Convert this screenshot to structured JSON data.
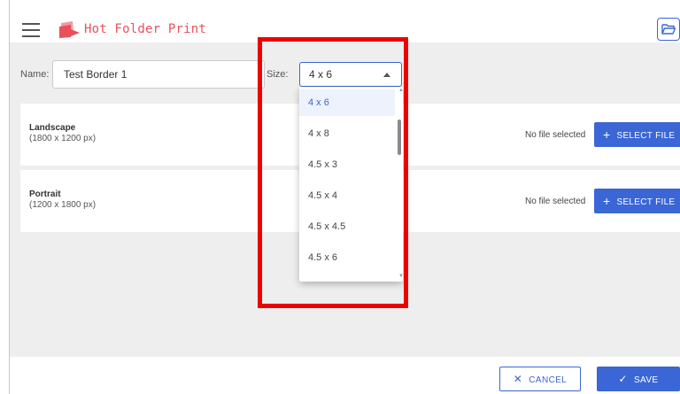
{
  "app": {
    "title": "Hot Folder Print",
    "accent_color": "#3b66d6",
    "logo_color": "#e8505b"
  },
  "form": {
    "name_label": "Name:",
    "name_value": "Test Border 1",
    "size_label": "Size:",
    "size_value": "4 x 6"
  },
  "size_options": [
    "4 x 6",
    "4 x 8",
    "4.5 x 3",
    "4.5 x 4",
    "4.5 x 4.5",
    "4.5 x 6"
  ],
  "panels": {
    "landscape": {
      "title": "Landscape",
      "subtitle": "(1800 x 1200 px)",
      "status": "No file selected",
      "button_label": "SELECT FILE",
      "button_icon": "plus-icon"
    },
    "portrait": {
      "title": "Portrait",
      "subtitle": "(1200 x 1800 px)",
      "status": "No file selected",
      "button_label": "SELECT FILE",
      "button_icon": "plus-icon"
    }
  },
  "footer": {
    "cancel_label": "CANCEL",
    "cancel_icon": "close-icon",
    "save_label": "SAVE",
    "save_icon": "check-icon"
  },
  "icons": {
    "menu": "hamburger-menu-icon",
    "folder": "folder-open-icon"
  },
  "highlight_color": "#ee0000"
}
